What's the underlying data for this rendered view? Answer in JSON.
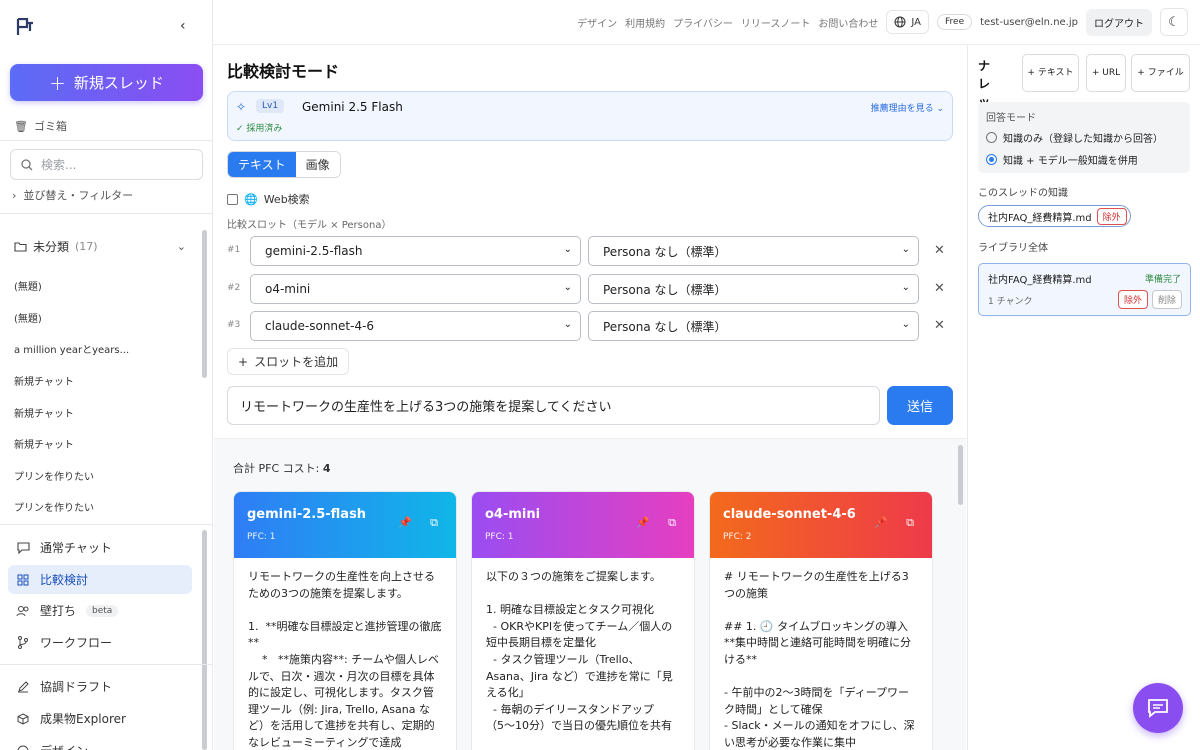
{
  "sidebar": {
    "new_thread": "新規スレッド",
    "trash": "ゴミ箱",
    "search_placeholder": "検索...",
    "sort_filter": "並び替え・フィルター",
    "folder": {
      "name": "未分類",
      "count": "(17)"
    },
    "threads": [
      "(無題)",
      "(無題)",
      "a million yearとyears...",
      "新規チャット",
      "新規チャット",
      "新規チャット",
      "プリンを作りたい",
      "プリンを作りたい"
    ],
    "nav": [
      {
        "label": "通常チャット",
        "icon": "chat-icon"
      },
      {
        "label": "比較検討",
        "icon": "grid-icon",
        "active": true
      },
      {
        "label": "壁打ち",
        "icon": "users-icon",
        "badge": "beta"
      },
      {
        "label": "ワークフロー",
        "icon": "flow-icon"
      },
      {
        "label": "協調ドラフト",
        "icon": "pen-icon"
      },
      {
        "label": "成果物Explorer",
        "icon": "cube-icon"
      },
      {
        "label": "デザイン",
        "icon": "design-icon"
      }
    ]
  },
  "header": {
    "links": [
      "デザイン",
      "利用規約",
      "プライバシー",
      "リリースノート",
      "お問い合わせ"
    ],
    "lang": "JA",
    "plan": "Free",
    "user": "test-user@eln.ne.jp",
    "logout": "ログアウト"
  },
  "main": {
    "title": "比較検討モード",
    "recommend": {
      "level": "Lv1",
      "model": "Gemini 2.5 Flash",
      "reason_link": "推薦理由を見る",
      "status": "✓ 採用済み"
    },
    "tabs": [
      "テキスト",
      "画像"
    ],
    "web_search": "Web検索",
    "slot_label": "比較スロット（モデル × Persona）",
    "slots": [
      {
        "num": "#1",
        "model": "gemini-2.5-flash",
        "persona": "Persona なし（標準）"
      },
      {
        "num": "#2",
        "model": "o4-mini",
        "persona": "Persona なし（標準）"
      },
      {
        "num": "#3",
        "model": "claude-sonnet-4-6",
        "persona": "Persona なし（標準）"
      }
    ],
    "add_slot": "スロットを追加",
    "prompt": "リモートワークの生産性を上げる3つの施策を提案してください",
    "send": "送信",
    "total_cost_label": "合計 PFC コスト:",
    "total_cost": "4",
    "cards": [
      {
        "name": "gemini-2.5-flash",
        "pfc": "PFC: 1",
        "gradient": "linear-gradient(90deg,#2f7df5,#10b6e8)",
        "text": "リモートワークの生産性を向上させるための3つの施策を提案します。\n\n1.  **明確な目標設定と進捗管理の徹底**\n    *   **施策内容**: チームや個人レベルで、日次・週次・月次の目標を具体的に設定し、可視化します。タスク管理ツール（例: Jira, Trello, Asana など）を活用して進捗を共有し、定期的なレビューミーティングで達成"
      },
      {
        "name": "o4-mini",
        "pfc": "PFC: 1",
        "gradient": "linear-gradient(90deg,#9a4df2,#e63fc0)",
        "text": "以下の３つの施策をご提案します。\n\n1. 明確な目標設定とタスク可視化\n  - OKRやKPIを使ってチーム／個人の短中長期目標を定量化\n  - タスク管理ツール（Trello、Asana、Jira など）で進捗を常に「見える化」\n  - 毎朝のデイリースタンドアップ（5〜10分）で当日の優先順位を共有"
      },
      {
        "name": "claude-sonnet-4-6",
        "pfc": "PFC: 2",
        "gradient": "linear-gradient(90deg,#f36a1c,#ee3a4a)",
        "text": "# リモートワークの生産性を上げる3つの施策\n\n## 1. 🕘 タイムブロッキングの導入\n**集中時間と連絡可能時間を明確に分ける**\n\n- 午前中の2〜3時間を「ディープワーク時間」として確保\n- Slack・メールの通知をオフにし、深い思考が必要な作業に集中"
      }
    ]
  },
  "knowledge": {
    "title": "ナレッジ",
    "buttons": [
      "+ テキスト",
      "+ URL",
      "+ ファイル"
    ],
    "mode_label": "回答モード",
    "modes": [
      {
        "label": "知識のみ（登録した知識から回答）",
        "selected": false
      },
      {
        "label": "知識 + モデル一般知識を併用",
        "selected": true
      }
    ],
    "thread_label": "このスレッドの知識",
    "thread_file": "社内FAQ_経費精算.md",
    "remove": "除外",
    "library_label": "ライブラリ全体",
    "library_file": "社内FAQ_経費精算.md",
    "library_status": "準備完了",
    "library_chunks": "1 チャンク",
    "delete": "削除"
  }
}
